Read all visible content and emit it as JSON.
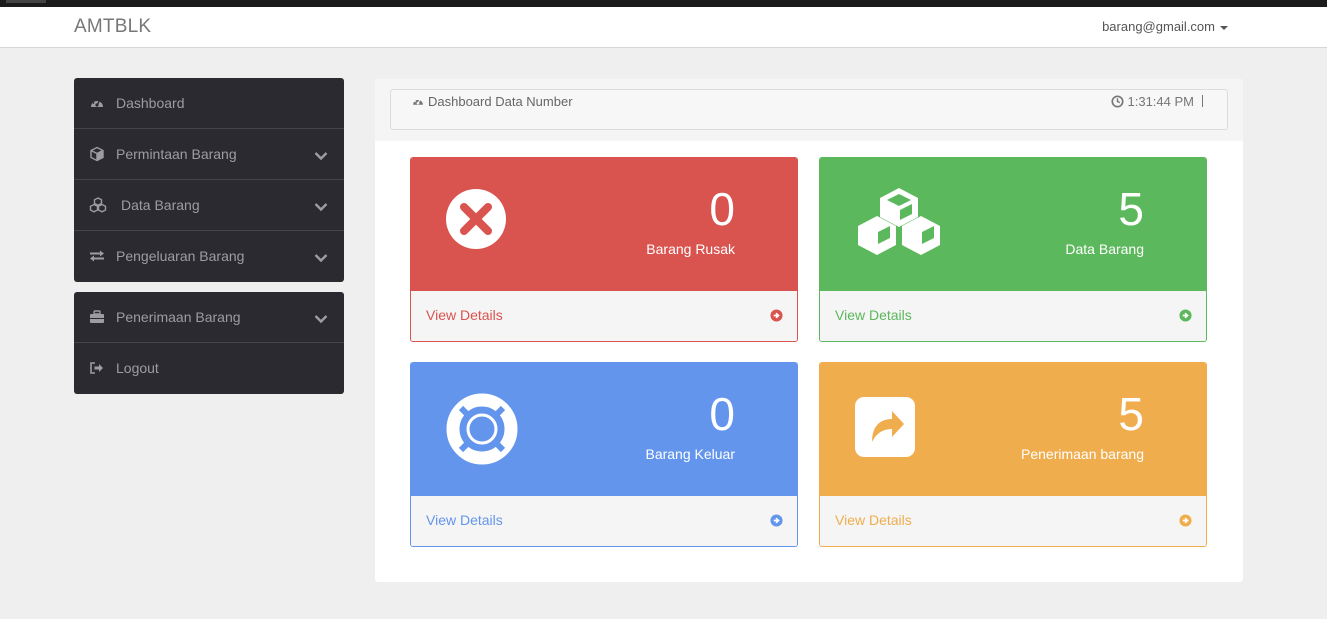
{
  "navbar": {
    "brand": "AMTBLK",
    "user_email": "barang@gmail.com"
  },
  "sidebar": {
    "groups": [
      {
        "items": [
          {
            "label": "Dashboard",
            "icon": "dashboard-icon",
            "has_chevron": false
          },
          {
            "label": "Permintaan Barang",
            "icon": "cube-icon",
            "has_chevron": true
          },
          {
            "label": "Data Barang",
            "icon": "cubes-icon",
            "has_chevron": true
          },
          {
            "label": "Pengeluaran Barang",
            "icon": "exchange-icon",
            "has_chevron": true
          }
        ]
      },
      {
        "items": [
          {
            "label": "Penerimaan Barang",
            "icon": "briefcase-icon",
            "has_chevron": true
          },
          {
            "label": "Logout",
            "icon": "sign-out-icon",
            "has_chevron": false
          }
        ]
      }
    ]
  },
  "panel": {
    "title": "Dashboard Data Number",
    "time": "1:31:44 PM"
  },
  "cards": [
    {
      "value": "0",
      "label": "Barang Rusak",
      "link": "View Details",
      "color": "#d9534f",
      "icon": "times-circle-icon"
    },
    {
      "value": "5",
      "label": "Data Barang",
      "link": "View Details",
      "color": "#5cb85c",
      "icon": "cubes-icon"
    },
    {
      "value": "0",
      "label": "Barang Keluar",
      "link": "View Details",
      "color": "#6495ed",
      "icon": "life-ring-icon"
    },
    {
      "value": "5",
      "label": "Penerimaan barang",
      "link": "View Details",
      "color": "#f0ad4e",
      "icon": "share-square-icon"
    }
  ]
}
